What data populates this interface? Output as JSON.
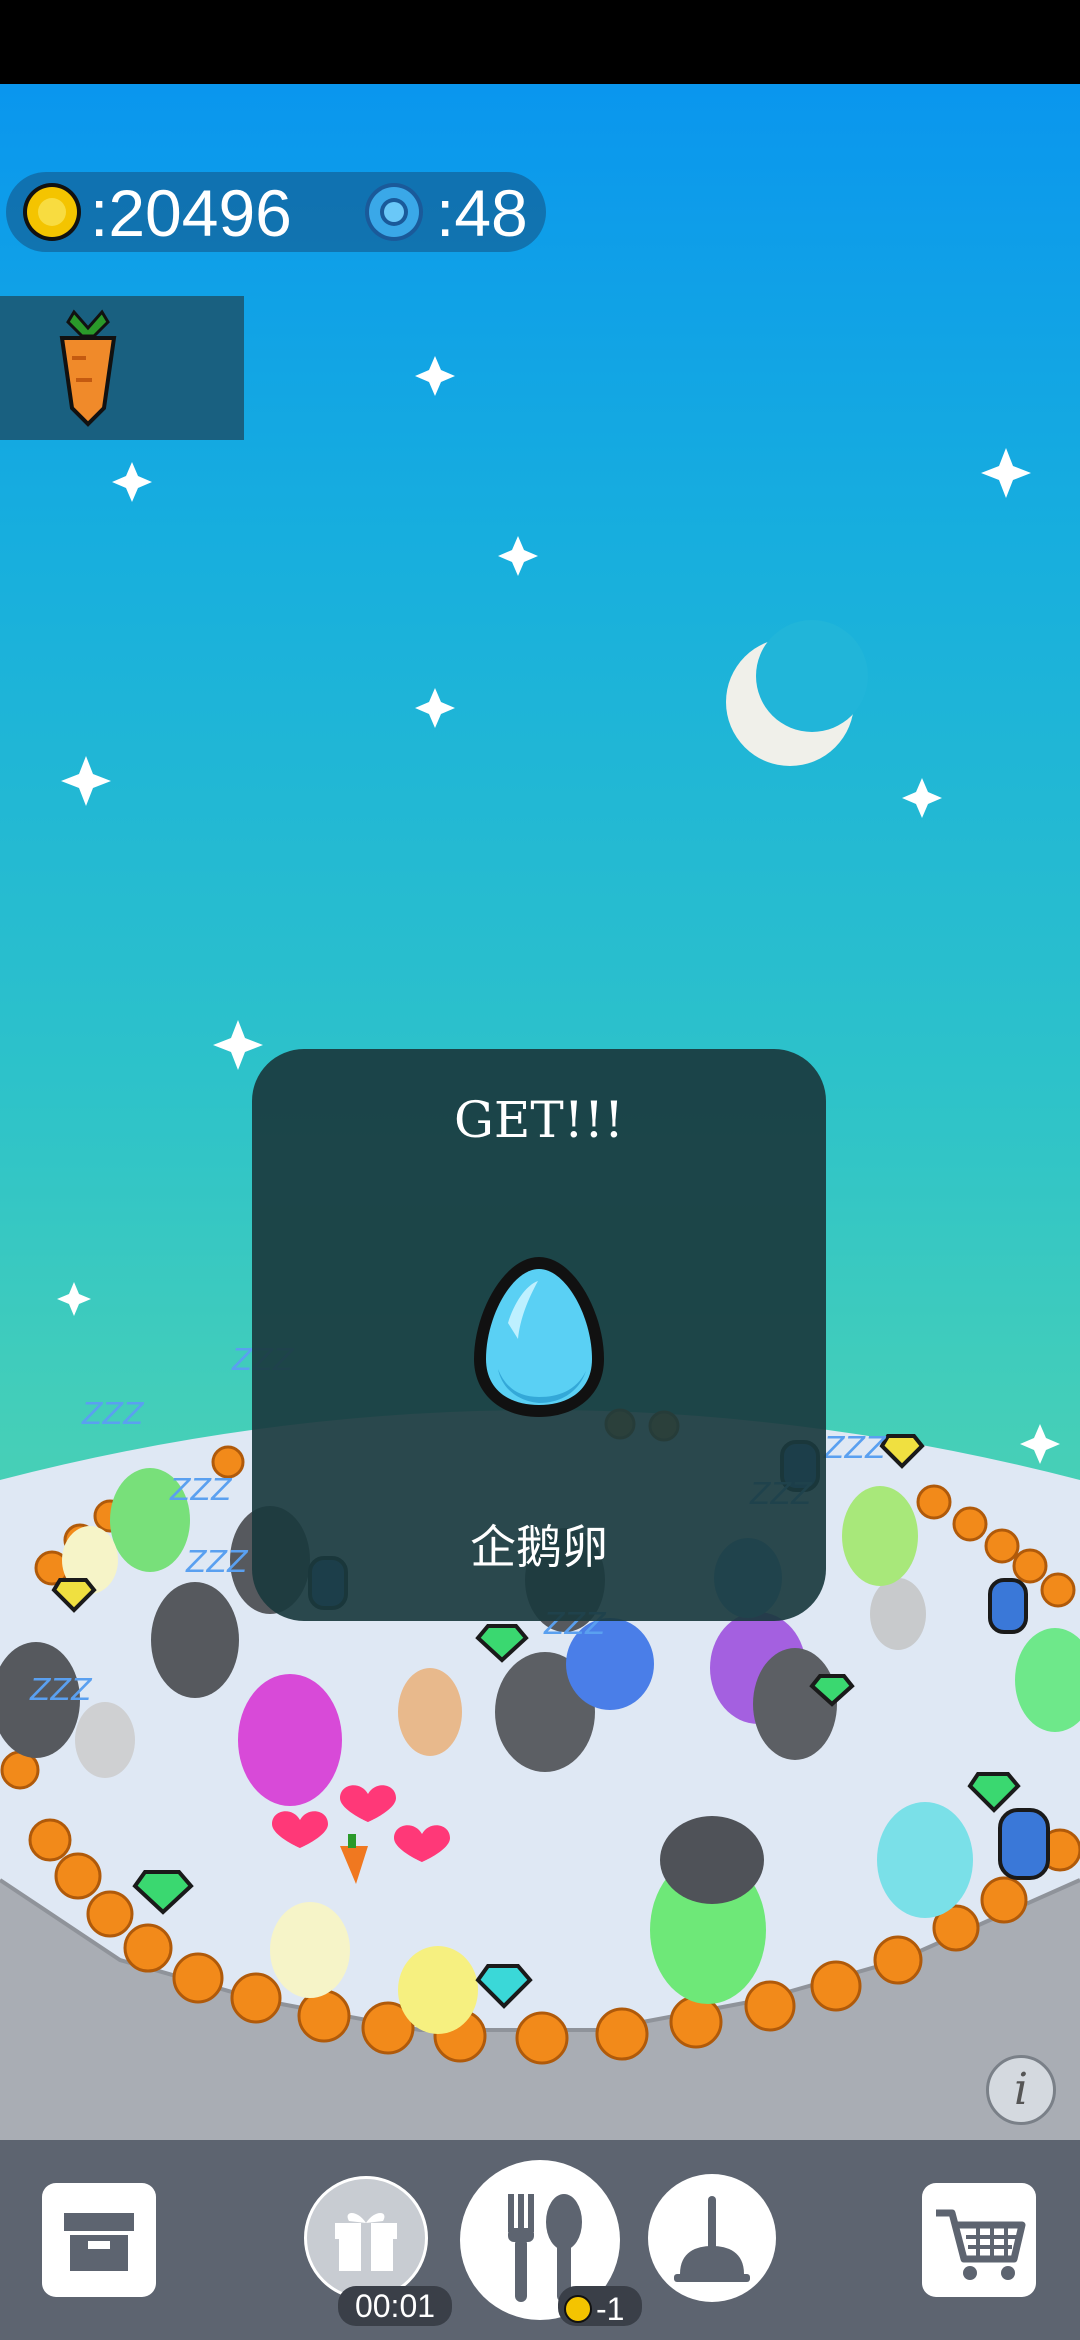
{
  "currency": {
    "coins_text": ":20496",
    "gems_text": ":48"
  },
  "food_slot": {
    "item_icon": "carrot-icon"
  },
  "modal": {
    "title": "GET!!!",
    "item_icon": "blue-egg-icon",
    "item_name": "企鹅卵"
  },
  "scene": {
    "sleep_text": "ZZZ",
    "icons": [
      "moon-icon",
      "star-sparkle-icon",
      "penguin-icon",
      "orange-icon",
      "gem-icon",
      "heart-icon",
      "egg-icon"
    ]
  },
  "toolbar": {
    "box_icon": "storage-box-icon",
    "gift_icon": "gift-icon",
    "gift_timer": "00:01",
    "feed_icon": "fork-spoon-icon",
    "feed_cost": "-1",
    "clean_icon": "plunger-icon",
    "shop_icon": "shopping-cart-icon",
    "info_label": "i"
  },
  "colors": {
    "sky_top": "#0a96ee",
    "sky_bottom": "#5ad6aa",
    "modal_bg": "#1a3a3e",
    "toolbar_bg": "#5d6470",
    "coin": "#f4c400",
    "gem": "#3aa8e8"
  }
}
